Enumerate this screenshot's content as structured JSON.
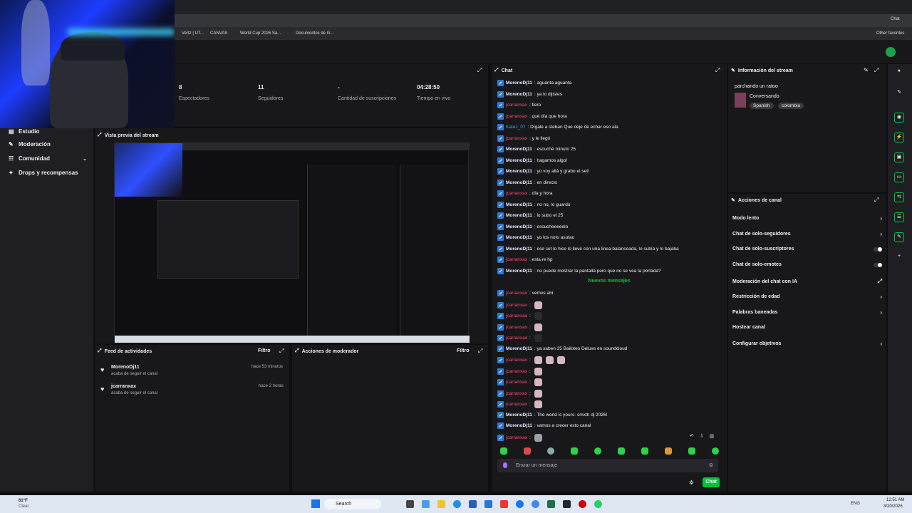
{
  "browser": {
    "bookmarks": [
      "Vertz | UT...",
      "CANVAS",
      "World Cup 2026 Sa...",
      "Documentos de G...",
      "Other favorites"
    ],
    "profile_label": "Chat"
  },
  "stats": [
    {
      "value": "8",
      "label": "Espectadores"
    },
    {
      "value": "11",
      "label": "Seguidores"
    },
    {
      "value": "-",
      "label": "Cantidad de suscripciones"
    },
    {
      "value": "04:28:50",
      "label": "Tiempo en vivo"
    }
  ],
  "sidebar": {
    "items": [
      {
        "label": "Estudio",
        "icon": "studio-icon"
      },
      {
        "label": "Moderación",
        "icon": "wrench-icon"
      },
      {
        "label": "Comunidad",
        "icon": "community-icon"
      },
      {
        "label": "Drops y recompensas",
        "icon": "gift-icon"
      }
    ]
  },
  "preview": {
    "title": "Vista previa del stream"
  },
  "activity": {
    "title": "Feed de actividades",
    "filter": "Filtro",
    "items": [
      {
        "user": "MorenoDj11",
        "text": "acaba de seguir el canal",
        "time": "hace 53 minutos"
      },
      {
        "user": "jcarranxax",
        "text": "acaba de seguir el canal",
        "time": "hace 2 horas"
      }
    ]
  },
  "mod_actions": {
    "title": "Acciones de moderador",
    "filter": "Filtro"
  },
  "chat": {
    "title": "Chat",
    "new_messages_label": "Nuevos mensajes",
    "messages": [
      {
        "user": "MorenoDj11",
        "text": ": aguanta aguanta",
        "cls": "u1"
      },
      {
        "user": "MorenoDj11",
        "text": ": ya lo dijistes",
        "cls": "u1"
      },
      {
        "user": "jcarranxax",
        "text": ": fiero",
        "cls": "u2"
      },
      {
        "user": "jcarranxax",
        "text": ": qué día que hora",
        "cls": "u2"
      },
      {
        "user": "KateJ_07",
        "text": ": Dígale a steban Que deje de echar eso ala",
        "cls": "u3"
      },
      {
        "user": "jcarranxax",
        "text": ": y le llegó",
        "cls": "u2"
      },
      {
        "user": "MorenoDj11",
        "text": ": escuché minuto 25",
        "cls": "u1"
      },
      {
        "user": "MorenoDj11",
        "text": ": hagamos algo!",
        "cls": "u1"
      },
      {
        "user": "MorenoDj11",
        "text": ": yo voy allá y grabo el set!",
        "cls": "u1"
      },
      {
        "user": "MorenoDj11",
        "text": ": en directo",
        "cls": "u1"
      },
      {
        "user": "jcarranxax",
        "text": ": día y hora",
        "cls": "u2"
      },
      {
        "user": "MorenoDj11",
        "text": ": no no, lo guardo",
        "cls": "u1"
      },
      {
        "user": "MorenoDj11",
        "text": ": lo subo el 25",
        "cls": "u1"
      },
      {
        "user": "MorenoDj11",
        "text": ": escucheeeeelo",
        "cls": "u1"
      },
      {
        "user": "MorenoDj11",
        "text": ": yo los noto asutao",
        "cls": "u1"
      },
      {
        "user": "MorenoDj11",
        "text": ": ese set lo hice lo llevé con una linea balanceada, lo subía y lo bajaba",
        "cls": "u1"
      },
      {
        "user": "jcarranxax",
        "text": ": esta re hp",
        "cls": "u2"
      },
      {
        "user": "MorenoDj11",
        "text": ": no puede mostrar la pantalla pero que no se vea la portada?",
        "cls": "u1"
      }
    ],
    "new_messages": [
      {
        "user": "jcarranxax",
        "text": ": vemos ahí",
        "cls": "u2",
        "emotes": 0
      },
      {
        "user": "jcarranxax",
        "text": ":",
        "cls": "u2",
        "emotes": 1
      },
      {
        "user": "jcarranxax",
        "text": ":",
        "cls": "u2",
        "emotes": 1,
        "dark": true
      },
      {
        "user": "jcarranxax",
        "text": ":",
        "cls": "u2",
        "emotes": 1
      },
      {
        "user": "jcarranxax",
        "text": ":",
        "cls": "u2",
        "emotes": 1,
        "dark": true
      },
      {
        "user": "MorenoDj11",
        "text": ": ya saben 25 Bailoteo Deluxe en soundcloud",
        "cls": "u1",
        "emotes": 0
      },
      {
        "user": "jcarranxax",
        "text": ":",
        "cls": "u2",
        "emotes": 3
      },
      {
        "user": "jcarranxax",
        "text": ":",
        "cls": "u2",
        "emotes": 1
      },
      {
        "user": "jcarranxax",
        "text": ":",
        "cls": "u2",
        "emotes": 1
      },
      {
        "user": "jcarranxax",
        "text": ":",
        "cls": "u2",
        "emotes": 1
      },
      {
        "user": "jcarranxax",
        "text": ":",
        "cls": "u2",
        "emotes": 1
      },
      {
        "user": "MorenoDj11",
        "text": ": The world is yours- smxth dj 2026!",
        "cls": "u1",
        "emotes": 0
      },
      {
        "user": "MorenoDj11",
        "text": ": vamos a crecer esto canal",
        "cls": "u1",
        "emotes": 0
      },
      {
        "user": "jcarranxax",
        "text": ":",
        "cls": "u2",
        "emotes": 1,
        "gray": true
      }
    ],
    "input_placeholder": "Enviar un mensaje",
    "send_label": "Chat"
  },
  "stream_info": {
    "title": "Información del stream",
    "stream_title": "parchando un ratoo",
    "category": "Conversando",
    "tags": [
      "Spanish",
      "colombia"
    ]
  },
  "channel_actions": {
    "title": "Acciones de canal",
    "items": [
      {
        "label": "Modo lento",
        "control": "chevron"
      },
      {
        "label": "Chat de solo-seguidores",
        "control": "chevron"
      },
      {
        "label": "Chat de solo-suscriptores",
        "control": "toggle"
      },
      {
        "label": "Chat de solo-emotes",
        "control": "toggle"
      },
      {
        "label": "Moderación del chat con IA",
        "control": "external"
      },
      {
        "label": "Restricción de edad",
        "control": "chevron"
      },
      {
        "label": "Palabras baneadas",
        "control": "chevron"
      },
      {
        "label": "Hostear canal",
        "control": "none"
      },
      {
        "label": "Configurar objetivos",
        "control": "chevron"
      }
    ]
  },
  "taskbar": {
    "weather": "61°F",
    "weather_sub": "Clear",
    "search": "Search",
    "lang": "ENG",
    "time": "12:51 AM",
    "date": "3/20/2026"
  },
  "colors": {
    "accent": "#00c43a",
    "bg": "#0e0e10",
    "panel": "#18181b",
    "new_msg": "#00c43a"
  }
}
